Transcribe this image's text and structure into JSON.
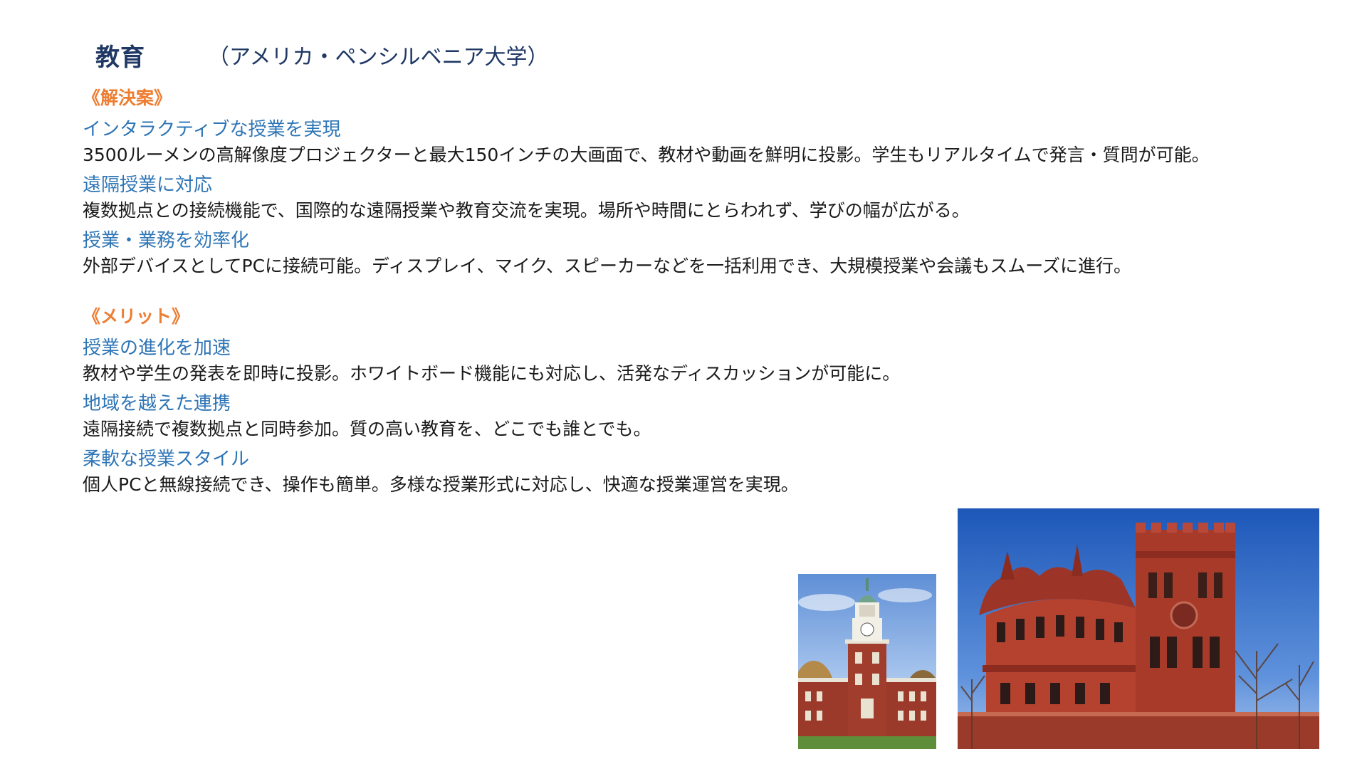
{
  "header": {
    "title": "教育",
    "subtitle": "（アメリカ・ペンシルベニア大学）"
  },
  "solution": {
    "heading": "《解決案》",
    "items": [
      {
        "title": "インタラクティブな授業を実現",
        "body": "3500ルーメンの高解像度プロジェクターと最大150インチの大画面で、教材や動画を鮮明に投影。学生もリアルタイムで発言・質問が可能。"
      },
      {
        "title": "遠隔授業に対応",
        "body": "複数拠点との接続機能で、国際的な遠隔授業や教育交流を実現。場所や時間にとらわれず、学びの幅が広がる。"
      },
      {
        "title": "授業・業務を効率化",
        "body": "外部デバイスとしてPCに接続可能。ディスプレイ、マイク、スピーカーなどを一括利用でき、大規模授業や会議もスムーズに進行。"
      }
    ]
  },
  "merit": {
    "heading": "《メリット》",
    "items": [
      {
        "title": "授業の進化を加速",
        "body": "教材や学生の発表を即時に投影。ホワイトボード機能にも対応し、活発なディスカッションが可能に。"
      },
      {
        "title": "地域を越えた連携",
        "body": "遠隔接続で複数拠点と同時参加。質の高い教育を、どこでも誰とでも。"
      },
      {
        "title": "柔軟な授業スタイル",
        "body": "個人PCと無線接続でき、操作も簡単。多様な授業形式に対応し、快適な授業運営を実現。"
      }
    ]
  },
  "colors": {
    "title": "#1f3864",
    "heading": "#ed7d31",
    "item_title": "#2e75b6",
    "body": "#1a1a1a"
  },
  "images": [
    {
      "name": "clock-tower-building-photo"
    },
    {
      "name": "red-brick-university-hall-photo"
    }
  ]
}
